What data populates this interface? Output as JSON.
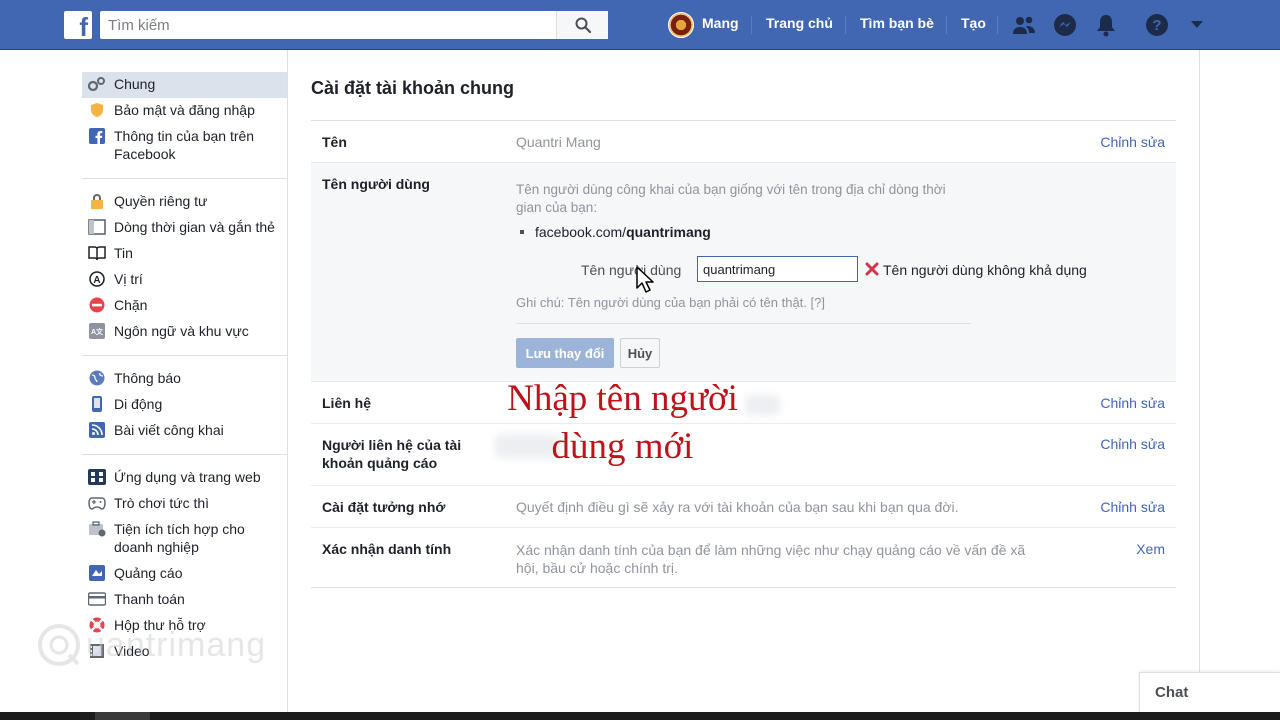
{
  "topbar": {
    "logo": "f",
    "search_placeholder": "Tìm kiếm",
    "profile_name": "Mang",
    "home_label": "Trang chủ",
    "find_friends_label": "Tìm bạn bè",
    "create_label": "Tạo"
  },
  "sidebar": {
    "groups": [
      [
        {
          "label": "Chung",
          "icon": "gear-icon",
          "active": true
        },
        {
          "label": "Bảo mật và đăng nhập",
          "icon": "shield-icon"
        },
        {
          "label": "Thông tin của bạn trên Facebook",
          "icon": "facebook-icon"
        }
      ],
      [
        {
          "label": "Quyền riêng tư",
          "icon": "lock-icon"
        },
        {
          "label": "Dòng thời gian và gắn thẻ",
          "icon": "timeline-icon"
        },
        {
          "label": "Tin",
          "icon": "book-icon"
        },
        {
          "label": "Vị trí",
          "icon": "location-icon"
        },
        {
          "label": "Chặn",
          "icon": "block-icon"
        },
        {
          "label": "Ngôn ngữ và khu vực",
          "icon": "language-icon"
        }
      ],
      [
        {
          "label": "Thông báo",
          "icon": "globe-icon"
        },
        {
          "label": "Di động",
          "icon": "mobile-icon"
        },
        {
          "label": "Bài viết công khai",
          "icon": "rss-icon"
        }
      ],
      [
        {
          "label": "Ứng dụng và trang web",
          "icon": "apps-icon"
        },
        {
          "label": "Trò chơi tức thì",
          "icon": "gamepad-icon"
        },
        {
          "label": "Tiện ích tích hợp cho doanh nghiệp",
          "icon": "business-integration-icon"
        },
        {
          "label": "Quảng cáo",
          "icon": "ads-icon"
        },
        {
          "label": "Thanh toán",
          "icon": "credit-card-icon"
        },
        {
          "label": "Hộp thư hỗ trợ",
          "icon": "lifebuoy-icon"
        },
        {
          "label": "Video",
          "icon": "film-icon"
        }
      ]
    ]
  },
  "main": {
    "title": "Cài đặt tài khoản chung",
    "rows": {
      "name": {
        "label": "Tên",
        "value": "Quantri Mang",
        "action": "Chỉnh sửa"
      },
      "username": {
        "label": "Tên người dùng",
        "description": "Tên người dùng công khai của bạn giống với tên trong địa chỉ dòng thời gian của bạn:",
        "url_prefix": "facebook.com/",
        "url_user": "quantrimang",
        "field_label": "Tên người dùng",
        "input_value": "quantrimang",
        "error_text": "Tên người dùng không khả dụng",
        "note": "Ghi chú: Tên người dùng của bạn phải có tên thật. [?]",
        "save_label": "Lưu thay đổi",
        "cancel_label": "Hủy"
      },
      "contact": {
        "label": "Liên hệ",
        "action": "Chỉnh sửa"
      },
      "ad_contacts": {
        "label": "Người liên hệ của tài khoản quảng cáo",
        "action": "Chỉnh sửa"
      },
      "memorial": {
        "label": "Cài đặt tưởng nhớ",
        "value": "Quyết định điều gì sẽ xảy ra với tài khoản của bạn sau khi bạn qua đời.",
        "action": "Chỉnh sửa"
      },
      "identity": {
        "label": "Xác nhận danh tính",
        "value": "Xác nhận danh tính của bạn để làm những việc như chạy quảng cáo về vấn đề xã hội, bầu cử hoặc chính trị.",
        "action": "Xem"
      }
    }
  },
  "overlay": {
    "caption_line1": "Nhập tên người",
    "caption_line2": "dùng mới"
  },
  "watermark": "uantrimang",
  "chat": {
    "label": "Chat"
  },
  "colors": {
    "brand": "#4267b2",
    "caption": "#c0121b",
    "error": "#d0344c"
  }
}
